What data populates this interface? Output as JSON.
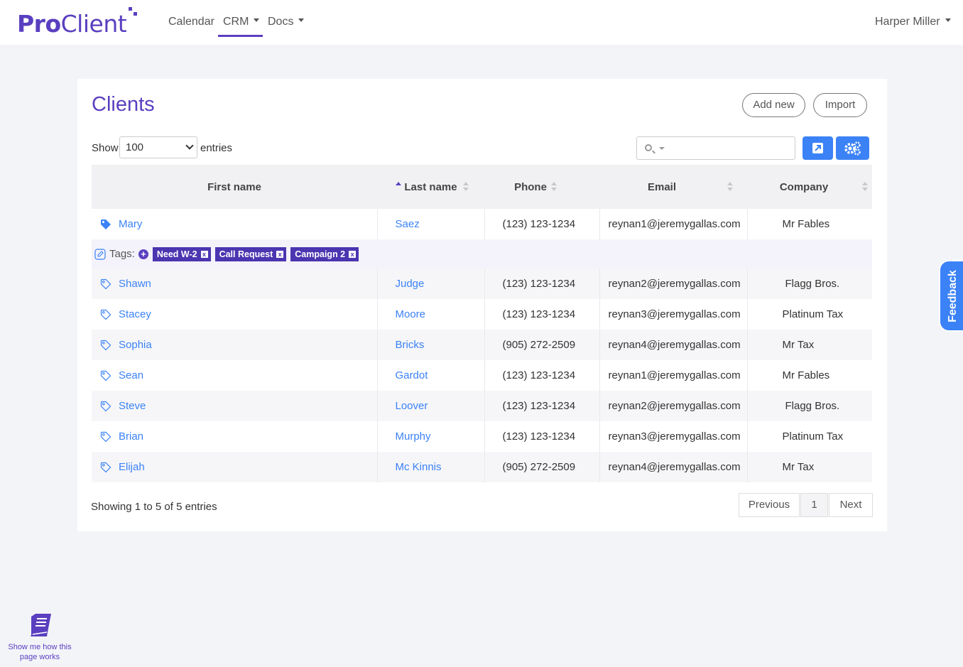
{
  "brand": {
    "pro": "Pro",
    "client": "Client",
    "color": "#5a3fc0"
  },
  "nav": {
    "calendar": "Calendar",
    "crm": "CRM",
    "docs": "Docs",
    "user": "Harper Miller"
  },
  "page": {
    "title": "Clients",
    "add_new": "Add new",
    "import": "Import",
    "show": "Show",
    "entries": "entries",
    "entries_value": "100",
    "search_value": ""
  },
  "columns": [
    "First name",
    "Last name",
    "Phone",
    "Email",
    "Company"
  ],
  "tags_row": {
    "label": "Tags:",
    "tags": [
      "Need W-2",
      "Call Request",
      "Campaign 2"
    ]
  },
  "rows": [
    {
      "first": "Mary",
      "last": "Saez",
      "phone": "(123) 123-1234",
      "email": "reynan1@jeremygallas.com",
      "company": "Mr Fables"
    },
    {
      "first": "Shawn",
      "last": "Judge",
      "phone": "(123) 123-1234",
      "email": "reynan2@jeremygallas.com",
      "company": "Flagg Bros."
    },
    {
      "first": "Stacey",
      "last": "Moore",
      "phone": "(123) 123-1234",
      "email": "reynan3@jeremygallas.com",
      "company": "Platinum Tax"
    },
    {
      "first": "Sophia",
      "last": "Bricks",
      "phone": "(905) 272-2509",
      "email": "reynan4@jeremygallas.com",
      "company": "Mr Tax"
    },
    {
      "first": "Sean",
      "last": "Gardot",
      "phone": "(123) 123-1234",
      "email": "reynan1@jeremygallas.com",
      "company": "Mr Fables"
    },
    {
      "first": "Steve",
      "last": "Loover",
      "phone": "(123) 123-1234",
      "email": "reynan2@jeremygallas.com",
      "company": "Flagg Bros."
    },
    {
      "first": "Brian",
      "last": "Murphy",
      "phone": "(123) 123-1234",
      "email": "reynan3@jeremygallas.com",
      "company": "Platinum Tax"
    },
    {
      "first": "Elijah",
      "last": "Mc Kinnis",
      "phone": "(905) 272-2509",
      "email": "reynan4@jeremygallas.com",
      "company": "Mr Tax"
    }
  ],
  "footer": {
    "showing": "Showing 1 to 5 of 5 entries",
    "previous": "Previous",
    "page": "1",
    "next": "Next"
  },
  "feedback": "Feedback",
  "help": {
    "line1": "Show me how this",
    "line2": "page works"
  },
  "colors": {
    "accent": "#5a3fc0",
    "link": "#3b82f6",
    "tag": "#4c35b0"
  }
}
